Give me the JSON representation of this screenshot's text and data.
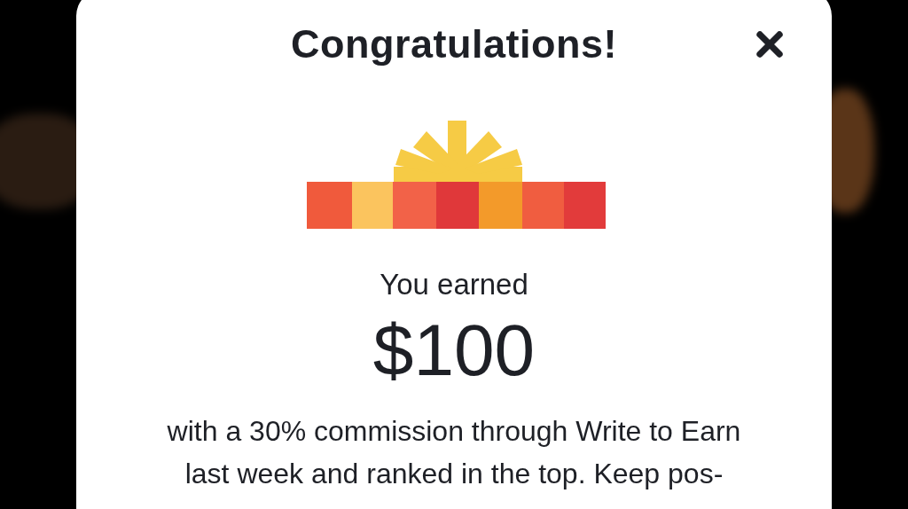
{
  "dialog": {
    "title": "Congratulations!",
    "subtitle": "You earned",
    "amount": "$100",
    "message": "with a 30% commission through Write to Earn\nlast week and ranked in the top. Keep pos-"
  }
}
